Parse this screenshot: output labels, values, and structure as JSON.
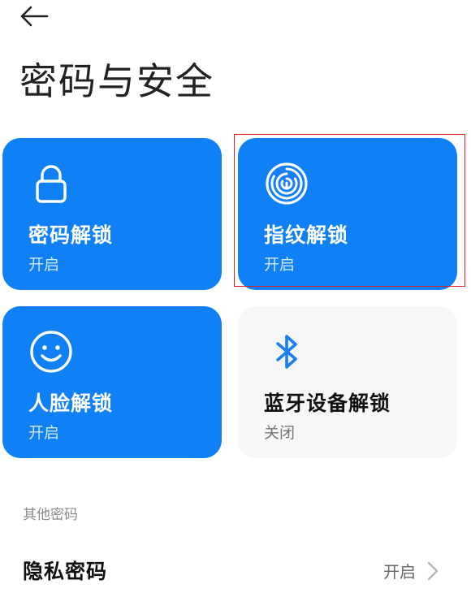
{
  "header": {
    "title": "密码与安全",
    "back_icon": "arrow-left-icon"
  },
  "tiles": [
    {
      "label": "密码解锁",
      "status": "开启",
      "icon": "lock-icon",
      "enabled": true
    },
    {
      "label": "指纹解锁",
      "status": "开启",
      "icon": "fingerprint-icon",
      "enabled": true
    },
    {
      "label": "人脸解锁",
      "status": "开启",
      "icon": "smiley-face-icon",
      "enabled": true
    },
    {
      "label": "蓝牙设备解锁",
      "status": "关闭",
      "icon": "bluetooth-icon",
      "enabled": false
    }
  ],
  "other_passwords": {
    "section_title": "其他密码",
    "rows": [
      {
        "label": "隐私密码",
        "value": "开启",
        "icon": "chevron-right-icon"
      }
    ]
  },
  "colors": {
    "tile_on": "#0f80f5",
    "tile_off": "#f6f7f8",
    "highlight": "#e02020",
    "bluetooth_icon": "#1a7ff0"
  }
}
